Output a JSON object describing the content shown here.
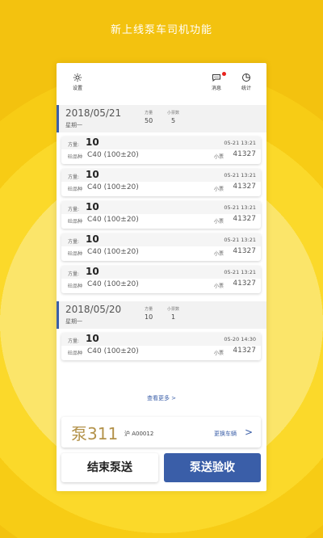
{
  "headline": "新上线泵车司机功能",
  "topbar": {
    "settings_label": "设置",
    "messages_label": "消息",
    "stats_label": "统计"
  },
  "days": [
    {
      "date": "2018/05/21",
      "weekday": "星期一",
      "volume_label": "方量",
      "volume": "50",
      "tickets_label": "小票数",
      "tickets": "5",
      "records": [
        {
          "qty_label": "方量:",
          "qty": "10",
          "time": "05-21  13:21",
          "grade_label": "砼品种",
          "grade": "C40 (100±20)",
          "ticket_label": "小票",
          "ticket": "41327"
        },
        {
          "qty_label": "方量:",
          "qty": "10",
          "time": "05-21  13:21",
          "grade_label": "砼品种",
          "grade": "C40 (100±20)",
          "ticket_label": "小票",
          "ticket": "41327"
        },
        {
          "qty_label": "方量:",
          "qty": "10",
          "time": "05-21  13:21",
          "grade_label": "砼品种",
          "grade": "C40 (100±20)",
          "ticket_label": "小票",
          "ticket": "41327"
        },
        {
          "qty_label": "方量:",
          "qty": "10",
          "time": "05-21  13:21",
          "grade_label": "砼品种",
          "grade": "C40 (100±20)",
          "ticket_label": "小票",
          "ticket": "41327"
        },
        {
          "qty_label": "方量:",
          "qty": "10",
          "time": "05-21  13:21",
          "grade_label": "砼品种",
          "grade": "C40 (100±20)",
          "ticket_label": "小票",
          "ticket": "41327"
        }
      ]
    },
    {
      "date": "2018/05/20",
      "weekday": "星期一",
      "volume_label": "方量",
      "volume": "10",
      "tickets_label": "小票数",
      "tickets": "1",
      "records": [
        {
          "qty_label": "方量:",
          "qty": "10",
          "time": "05-20  14:30",
          "grade_label": "砼品种",
          "grade": "C40 (100±20)",
          "ticket_label": "小票",
          "ticket": "41327"
        }
      ]
    }
  ],
  "see_more": "查看更多 >",
  "pump": {
    "name": "泵311",
    "plate": "沪 A00012",
    "switch_label": "更换车辆",
    "switch_arrow": ">"
  },
  "actions": {
    "end_label": "结束泵送",
    "accept_label": "泵送验收"
  },
  "colors": {
    "accent": "#3a5ea8",
    "badge": "#e8221c",
    "pump_name": "#b3924a",
    "background": "#f9d31c"
  }
}
